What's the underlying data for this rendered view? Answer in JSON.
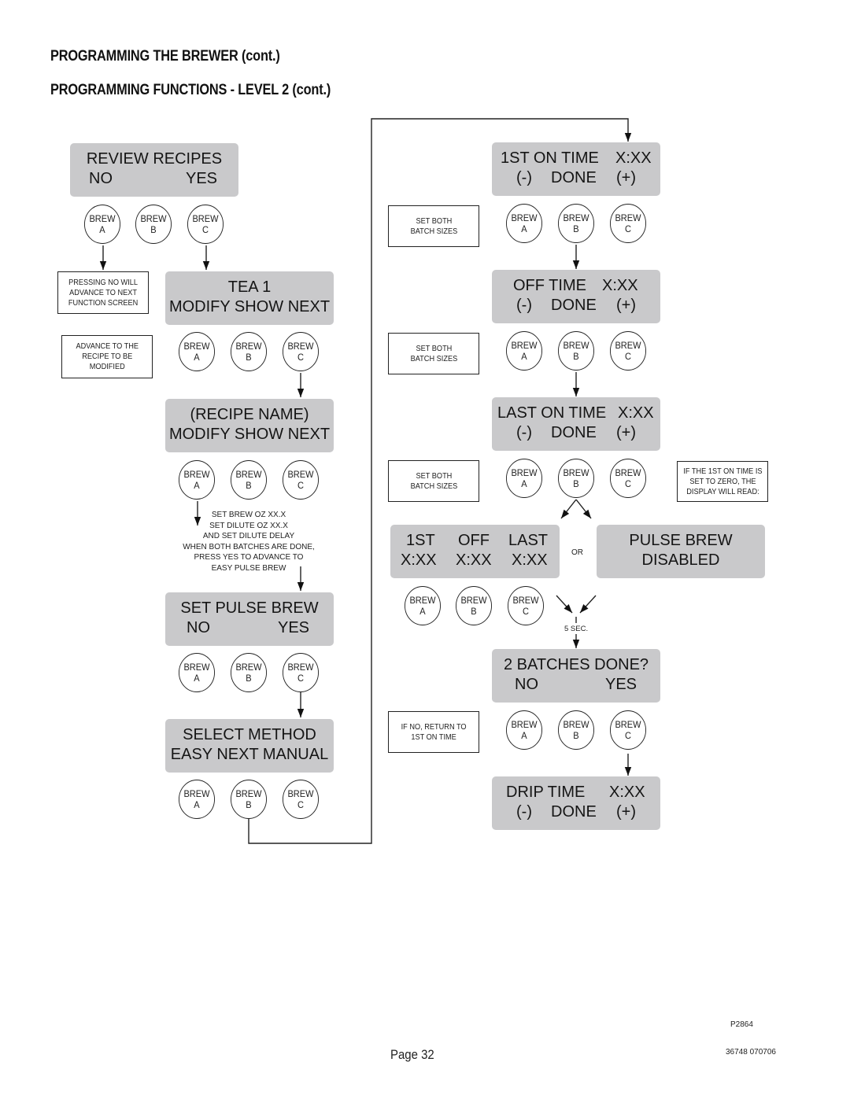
{
  "header": {
    "title": "PROGRAMMING THE BREWER (cont.)",
    "subtitle": "PROGRAMMING FUNCTIONS - LEVEL  2 (cont.)"
  },
  "button_labels": {
    "top": "BREW",
    "a": "A",
    "b": "B",
    "c": "C"
  },
  "screens": {
    "review_recipes": {
      "line1": "REVIEW RECIPES",
      "line2_left": "NO",
      "line2_right": "YES"
    },
    "tea1": {
      "line1": "TEA 1",
      "line2": "MODIFY SHOW NEXT"
    },
    "recipe_name": {
      "line1": "(RECIPE NAME)",
      "line2": "MODIFY SHOW NEXT"
    },
    "set_pulse_brew": {
      "line1": "SET PULSE BREW",
      "line2_left": "NO",
      "line2_right": "YES"
    },
    "select_method": {
      "line1": "SELECT METHOD",
      "line2": "EASY NEXT MANUAL"
    },
    "first_on_time": {
      "label": "1ST ON TIME",
      "value": "X:XX",
      "minus": "(-)",
      "done": "DONE",
      "plus": "(+)"
    },
    "off_time": {
      "label": "OFF TIME",
      "value": "X:XX",
      "minus": "(-)",
      "done": "DONE",
      "plus": "(+)"
    },
    "last_on_time": {
      "label": "LAST ON TIME",
      "value": "X:XX",
      "minus": "(-)",
      "done": "DONE",
      "plus": "(+)"
    },
    "summary": {
      "col1_label": "1ST",
      "col2_label": "OFF",
      "col3_label": "LAST",
      "col1_value": "X:XX",
      "col2_value": "X:XX",
      "col3_value": "X:XX"
    },
    "pulse_brew_disabled": {
      "line1": "PULSE BREW",
      "line2": "DISABLED"
    },
    "batches_done": {
      "line1": "2 BATCHES DONE?",
      "line2_left": "NO",
      "line2_right": "YES"
    },
    "drip_time": {
      "label": "DRIP TIME",
      "value": "X:XX",
      "minus": "(-)",
      "done": "DONE",
      "plus": "(+)"
    }
  },
  "notes": {
    "pressing_no": "PRESSING NO WILL\nADVANCE TO NEXT\nFUNCTION SCREEN",
    "advance_recipe": "ADVANCE TO THE\nRECIPE TO BE\nMODIFIED",
    "set_brew_instructions": "SET BREW OZ  XX.X\nSET DILUTE OZ  XX.X\nAND SET DILUTE DELAY\nWHEN BOTH BATCHES ARE DONE,\nPRESS YES TO ADVANCE TO\nEASY PULSE BREW",
    "set_both_1": "SET BOTH\nBATCH SIZES",
    "set_both_2": "SET BOTH\nBATCH SIZES",
    "set_both_3": "SET BOTH\nBATCH SIZES",
    "if_first_zero": "IF THE 1ST ON TIME IS\nSET TO ZERO, THE\nDISPLAY WILL READ:",
    "if_no_return": "IF NO, RETURN TO\n1ST ON TIME",
    "or": "OR",
    "five_sec": "5 SEC."
  },
  "footer": {
    "figure_id": "P2864",
    "page": "Page 32",
    "doc_number": "36748 070706"
  }
}
